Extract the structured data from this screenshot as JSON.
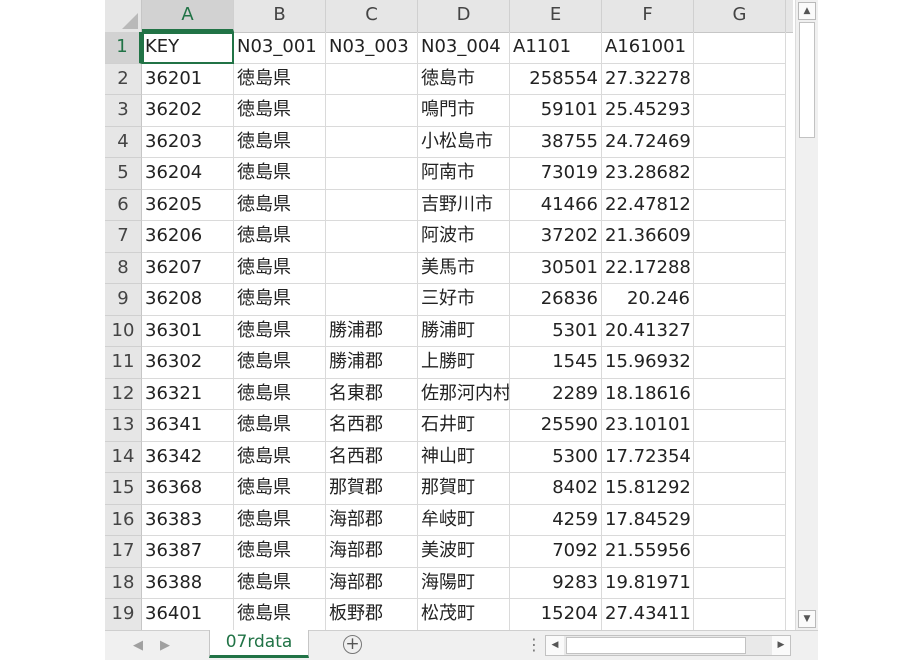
{
  "sheet": {
    "columns": [
      "A",
      "B",
      "C",
      "D",
      "E",
      "F",
      "G"
    ],
    "selected_column": "A",
    "selected_row": "1",
    "rows": [
      {
        "n": "1",
        "cells": [
          "KEY",
          "N03_001",
          "N03_003",
          "N03_004",
          "A1101",
          "A161001",
          ""
        ]
      },
      {
        "n": "2",
        "cells": [
          "36201",
          "徳島県",
          "",
          "徳島市",
          "258554",
          "27.32278",
          ""
        ]
      },
      {
        "n": "3",
        "cells": [
          "36202",
          "徳島県",
          "",
          "鳴門市",
          "59101",
          "25.45293",
          ""
        ]
      },
      {
        "n": "4",
        "cells": [
          "36203",
          "徳島県",
          "",
          "小松島市",
          "38755",
          "24.72469",
          ""
        ]
      },
      {
        "n": "5",
        "cells": [
          "36204",
          "徳島県",
          "",
          "阿南市",
          "73019",
          "23.28682",
          ""
        ]
      },
      {
        "n": "6",
        "cells": [
          "36205",
          "徳島県",
          "",
          "吉野川市",
          "41466",
          "22.47812",
          ""
        ]
      },
      {
        "n": "7",
        "cells": [
          "36206",
          "徳島県",
          "",
          "阿波市",
          "37202",
          "21.36609",
          ""
        ]
      },
      {
        "n": "8",
        "cells": [
          "36207",
          "徳島県",
          "",
          "美馬市",
          "30501",
          "22.17288",
          ""
        ]
      },
      {
        "n": "9",
        "cells": [
          "36208",
          "徳島県",
          "",
          "三好市",
          "26836",
          "20.246",
          ""
        ]
      },
      {
        "n": "10",
        "cells": [
          "36301",
          "徳島県",
          "勝浦郡",
          "勝浦町",
          "5301",
          "20.41327",
          ""
        ]
      },
      {
        "n": "11",
        "cells": [
          "36302",
          "徳島県",
          "勝浦郡",
          "上勝町",
          "1545",
          "15.96932",
          ""
        ]
      },
      {
        "n": "12",
        "cells": [
          "36321",
          "徳島県",
          "名東郡",
          "佐那河内村",
          "2289",
          "18.18616",
          ""
        ]
      },
      {
        "n": "13",
        "cells": [
          "36341",
          "徳島県",
          "名西郡",
          "石井町",
          "25590",
          "23.10101",
          ""
        ]
      },
      {
        "n": "14",
        "cells": [
          "36342",
          "徳島県",
          "名西郡",
          "神山町",
          "5300",
          "17.72354",
          ""
        ]
      },
      {
        "n": "15",
        "cells": [
          "36368",
          "徳島県",
          "那賀郡",
          "那賀町",
          "8402",
          "15.81292",
          ""
        ]
      },
      {
        "n": "16",
        "cells": [
          "36383",
          "徳島県",
          "海部郡",
          "牟岐町",
          "4259",
          "17.84529",
          ""
        ]
      },
      {
        "n": "17",
        "cells": [
          "36387",
          "徳島県",
          "海部郡",
          "美波町",
          "7092",
          "21.55956",
          ""
        ]
      },
      {
        "n": "18",
        "cells": [
          "36388",
          "徳島県",
          "海部郡",
          "海陽町",
          "9283",
          "19.81971",
          ""
        ]
      },
      {
        "n": "19",
        "cells": [
          "36401",
          "徳島県",
          "板野郡",
          "松茂町",
          "15204",
          "27.43411",
          ""
        ]
      }
    ]
  },
  "tabs": {
    "active_tab": "07rdata",
    "add_sheet_symbol": "+"
  },
  "colors": {
    "accent": "#217346",
    "header_bg": "#e6e6e6"
  },
  "icons": {
    "corner": "select-all-triangle-icon",
    "scroll_up": "scroll-up-arrow-icon",
    "scroll_down": "scroll-down-arrow-icon",
    "scroll_left": "scroll-left-arrow-icon",
    "scroll_right": "scroll-right-arrow-icon",
    "prev_sheet": "prev-sheet-arrow-icon",
    "next_sheet": "next-sheet-arrow-icon"
  }
}
